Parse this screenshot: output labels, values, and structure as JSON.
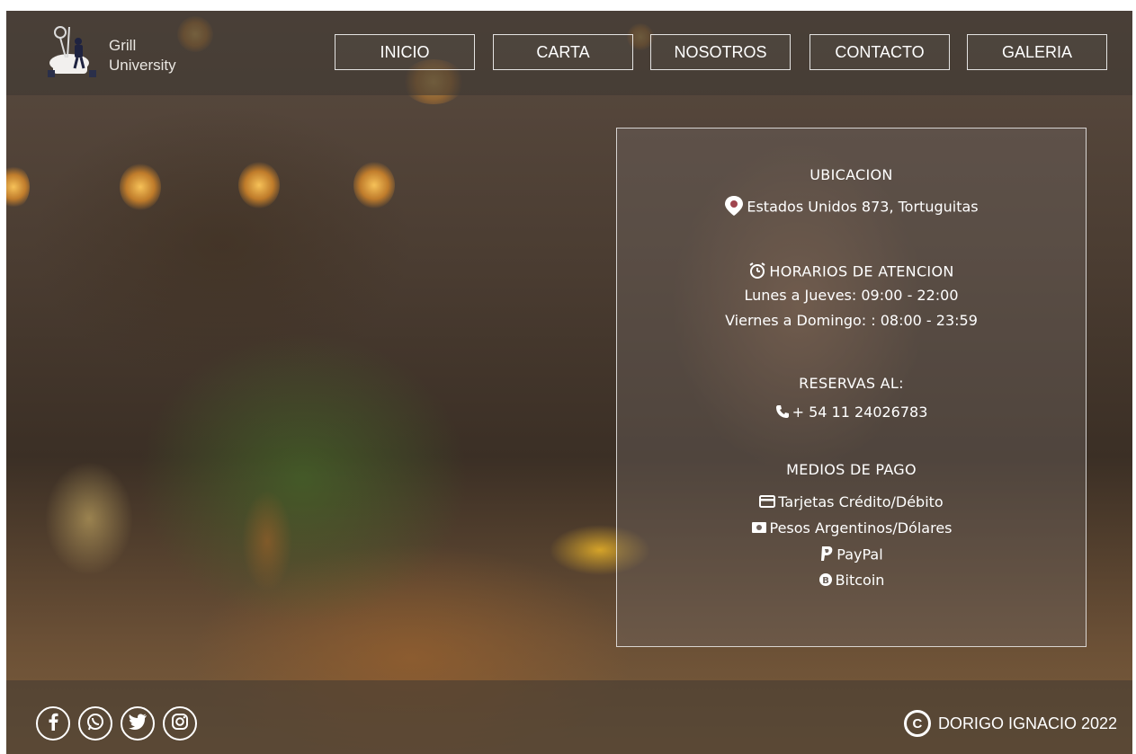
{
  "brand": {
    "line1": "Grill",
    "line2": "University",
    "logo_icon": "chef-with-utensils-logo"
  },
  "nav": {
    "items": [
      {
        "label": "INICIO"
      },
      {
        "label": "CARTA"
      },
      {
        "label": "NOSOTROS"
      },
      {
        "label": "CONTACTO"
      },
      {
        "label": "GALERIA"
      }
    ]
  },
  "info": {
    "location": {
      "heading": "UBICACION",
      "icon": "map-pin-icon",
      "address": "Estados Unidos 873, Tortuguitas"
    },
    "hours": {
      "icon": "alarm-clock-icon",
      "heading": "HORARIOS DE ATENCION",
      "line1": "Lunes a Jueves: 09:00 - 22:00",
      "line2": "Viernes a Domingo: : 08:00 - 23:59"
    },
    "reservations": {
      "heading": "RESERVAS AL:",
      "icon": "phone-icon",
      "phone": "+ 54 11 24026783"
    },
    "payment": {
      "heading": "MEDIOS DE PAGO",
      "methods": [
        {
          "icon": "credit-card-icon",
          "label": "Tarjetas Crédito/Débito"
        },
        {
          "icon": "cash-icon",
          "label": "Pesos Argentinos/Dólares"
        },
        {
          "icon": "paypal-icon",
          "label": "PayPal"
        },
        {
          "icon": "bitcoin-icon",
          "label": "Bitcoin"
        }
      ]
    }
  },
  "footer": {
    "social": [
      {
        "icon": "facebook-icon"
      },
      {
        "icon": "whatsapp-icon"
      },
      {
        "icon": "twitter-icon"
      },
      {
        "icon": "instagram-icon"
      }
    ],
    "copyright_symbol": "C",
    "copyright_text": "DORIGO IGNACIO 2022"
  },
  "colors": {
    "text": "#ffffff",
    "overlay_border": "#ffffff"
  }
}
